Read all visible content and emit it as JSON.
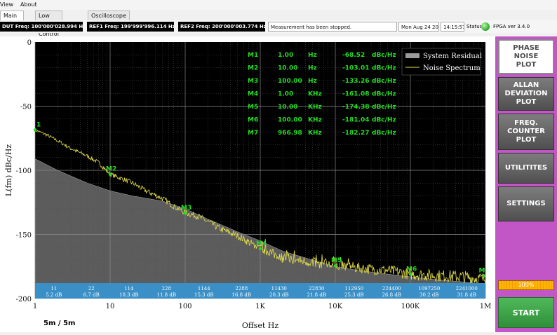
{
  "menu": [
    "View",
    "About"
  ],
  "tabs": [
    {
      "label": "Main Board",
      "active": true
    },
    {
      "label": "Low Level Control",
      "active": false
    },
    {
      "label": "Oscilloscope",
      "active": false
    }
  ],
  "status": {
    "dut": "DUT Freq: 100'000'028.994 Hz",
    "ref1": "REF1 Freq: 199'999'996.114 Hz",
    "ref2": "REF2 Freq: 200'000'003.774 Hz",
    "message": "Measurement has been stopped.",
    "date": "Mon Aug 24 2020",
    "time": "14:15:57",
    "status_label": "Status",
    "fpga": "FPGA ver 3.4.0"
  },
  "side_buttons": [
    {
      "label": "PHASE\nNOISE\nPLOT",
      "active": true
    },
    {
      "label": "ALLAN\nDEVIATION\nPLOT",
      "active": false
    },
    {
      "label": "FREQ.\nCOUNTER\nPLOT",
      "active": false
    },
    {
      "label": "UTILITITES",
      "active": false
    },
    {
      "label": "SETTINGS",
      "active": false
    }
  ],
  "progress": {
    "label": "100%",
    "value": 100
  },
  "start_label": "START",
  "plot": {
    "averaging": "5m / 5m",
    "chart_data": {
      "type": "line",
      "xlabel": "Offset Hz",
      "ylabel": "L(fm) dBc/Hz",
      "xscale": "log",
      "xlim": [
        1,
        1000000
      ],
      "ylim": [
        -200,
        0
      ],
      "yticks": [
        0,
        -50,
        -100,
        -150,
        -200
      ],
      "xticks": [
        {
          "value": 1,
          "label": "1"
        },
        {
          "value": 10,
          "label": "10"
        },
        {
          "value": 100,
          "label": "100"
        },
        {
          "value": 1000,
          "label": "1K"
        },
        {
          "value": 10000,
          "label": "10K"
        },
        {
          "value": 100000,
          "label": "100K"
        },
        {
          "value": 1000000,
          "label": "1M"
        }
      ],
      "legend": {
        "position": "top-right",
        "entries": [
          "System Residual",
          "Noise Spectrum"
        ]
      },
      "colors": {
        "background": "#000000",
        "residual": "#a8a8a8",
        "spectrum": "#e6e04a",
        "marker": "#22dd22",
        "grid": "#505050",
        "band": "#3a8fc6"
      },
      "series": [
        {
          "name": "System Residual",
          "x": [
            1,
            2,
            5,
            10,
            20,
            50,
            100,
            200,
            500,
            1000,
            2000,
            5000,
            10000,
            20000,
            50000,
            100000,
            200000,
            500000,
            1000000
          ],
          "y": [
            -91,
            -100,
            -110,
            -116,
            -120,
            -124,
            -130,
            -138,
            -148,
            -155,
            -163,
            -170,
            -175,
            -178,
            -181,
            -183,
            -185,
            -187,
            -189
          ]
        },
        {
          "name": "Noise Spectrum",
          "x": [
            1,
            1.5,
            2,
            3,
            5,
            7,
            10,
            15,
            20,
            30,
            50,
            70,
            100,
            150,
            200,
            300,
            500,
            700,
            1000,
            1500,
            2000,
            3000,
            5000,
            7000,
            10000,
            15000,
            20000,
            30000,
            50000,
            70000,
            100000,
            150000,
            200000,
            300000,
            500000,
            700000,
            1000000
          ],
          "y": [
            -68.5,
            -73,
            -77,
            -83,
            -89,
            -94,
            -103,
            -107,
            -110,
            -116,
            -122,
            -128,
            -133,
            -136,
            -140,
            -146,
            -151,
            -156,
            -161,
            -165,
            -168,
            -170,
            -172,
            -173,
            -174.4,
            -175,
            -176,
            -177,
            -178,
            -179.5,
            -181,
            -181.5,
            -182,
            -182.3,
            -183,
            -184,
            -185
          ]
        }
      ],
      "markers": [
        {
          "name": "M1",
          "freq": "1.00",
          "unit": "Hz",
          "value": "-68.52",
          "vunit": "dBc/Hz",
          "x": 1,
          "y": -68.52,
          "plot_label": "1"
        },
        {
          "name": "M2",
          "freq": "10.00",
          "unit": "Hz",
          "value": "-103.01",
          "vunit": "dBc/Hz",
          "x": 10,
          "y": -103.01,
          "plot_label": "M2"
        },
        {
          "name": "M3",
          "freq": "100.00",
          "unit": "Hz",
          "value": "-133.26",
          "vunit": "dBc/Hz",
          "x": 100,
          "y": -133.26,
          "plot_label": "M3"
        },
        {
          "name": "M4",
          "freq": "1.00",
          "unit": "KHz",
          "value": "-161.08",
          "vunit": "dBc/Hz",
          "x": 1000,
          "y": -161.08,
          "plot_label": "M4"
        },
        {
          "name": "M5",
          "freq": "10.00",
          "unit": "KHz",
          "value": "-174.38",
          "vunit": "dBc/Hz",
          "x": 10000,
          "y": -174.38,
          "plot_label": "M5"
        },
        {
          "name": "M6",
          "freq": "100.00",
          "unit": "KHz",
          "value": "-181.04",
          "vunit": "dBc/Hz",
          "x": 100000,
          "y": -181.04,
          "plot_label": "M6"
        },
        {
          "name": "M7",
          "freq": "966.98",
          "unit": "KHz",
          "value": "-182.27",
          "vunit": "dBc/Hz",
          "x": 966980,
          "y": -182.27,
          "plot_label": "M"
        }
      ],
      "decade_band": [
        {
          "count": "11",
          "db": "5.2 dB"
        },
        {
          "count": "22",
          "db": "6.7 dB"
        },
        {
          "count": "114",
          "db": "10.3 dB"
        },
        {
          "count": "228",
          "db": "11.8 dB"
        },
        {
          "count": "1144",
          "db": "15.3 dB"
        },
        {
          "count": "2288",
          "db": "16.8 dB"
        },
        {
          "count": "11430",
          "db": "20.3 dB"
        },
        {
          "count": "22830",
          "db": "21.8 dB"
        },
        {
          "count": "112950",
          "db": "25.3 dB"
        },
        {
          "count": "224400",
          "db": "26.8 dB"
        },
        {
          "count": "1097250",
          "db": "30.2 dB"
        },
        {
          "count": "2241000",
          "db": "31.8 dB"
        }
      ]
    }
  }
}
